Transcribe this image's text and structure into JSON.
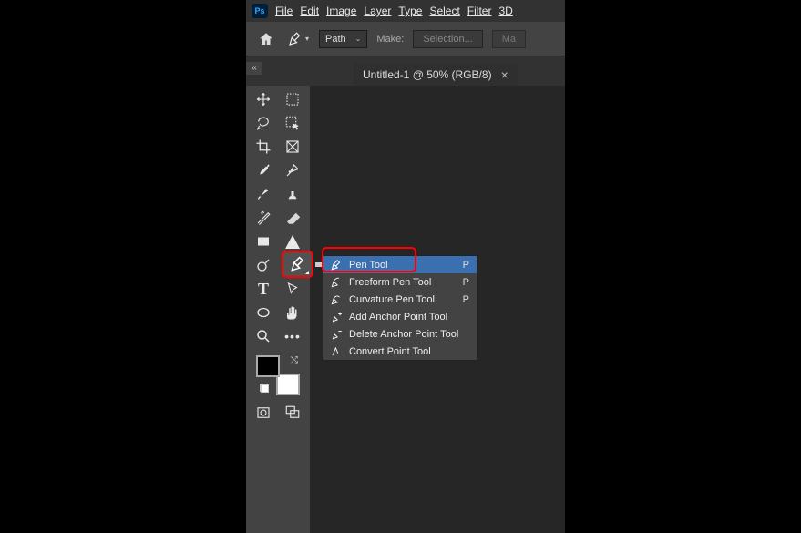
{
  "menu": [
    "File",
    "Edit",
    "Image",
    "Layer",
    "Type",
    "Select",
    "Filter",
    "3D"
  ],
  "options": {
    "path_mode": "Path",
    "make_label": "Make:",
    "selection_label": "Selection...",
    "ma_cut": "Ma"
  },
  "tab": {
    "title": "Untitled-1 @ 50% (RGB/8)",
    "close": "×"
  },
  "flyout": [
    {
      "name": "Pen Tool",
      "key": "P",
      "selected": true,
      "icon": "pen"
    },
    {
      "name": "Freeform Pen Tool",
      "key": "P",
      "selected": false,
      "icon": "freeform"
    },
    {
      "name": "Curvature Pen Tool",
      "key": "P",
      "selected": false,
      "icon": "curve"
    },
    {
      "name": "Add Anchor Point Tool",
      "key": "",
      "selected": false,
      "icon": "add"
    },
    {
      "name": "Delete Anchor Point Tool",
      "key": "",
      "selected": false,
      "icon": "delete"
    },
    {
      "name": "Convert Point Tool",
      "key": "",
      "selected": false,
      "icon": "convert"
    }
  ],
  "logo": "Ps",
  "collapse": "«"
}
